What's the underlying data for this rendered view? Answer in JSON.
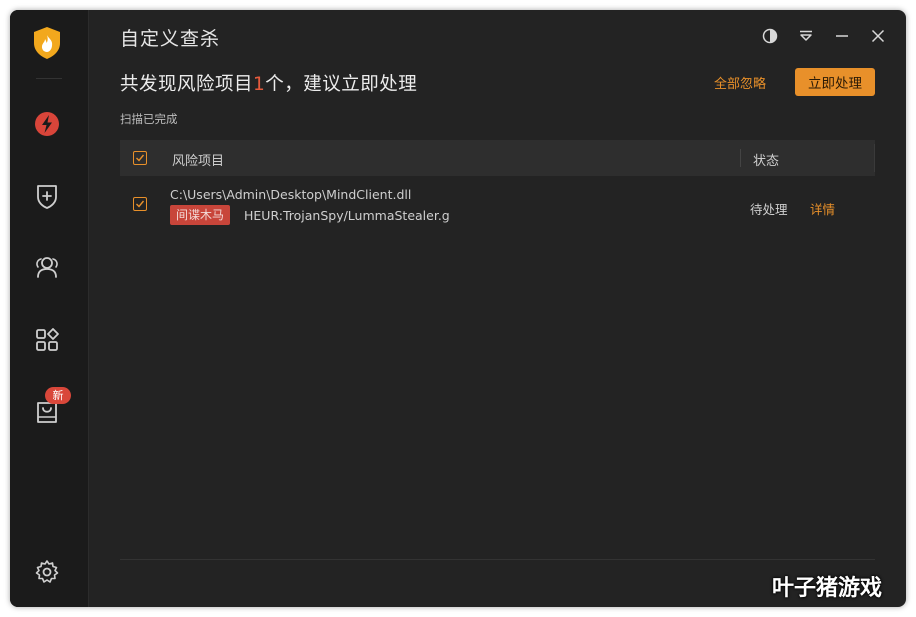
{
  "window": {
    "title": "自定义查杀",
    "controls": [
      "theme-icon",
      "menu-icon",
      "minimize-icon",
      "close-icon"
    ]
  },
  "sidebar": {
    "items": [
      {
        "name": "quick-scan",
        "icon": "lightning-icon",
        "active": true
      },
      {
        "name": "protection",
        "icon": "shield-plus-icon"
      },
      {
        "name": "users",
        "icon": "users-icon"
      },
      {
        "name": "apps",
        "icon": "apps-grid-icon"
      },
      {
        "name": "toolbox",
        "icon": "bag-icon",
        "badge": "新"
      }
    ],
    "settings_icon": "gear-icon"
  },
  "summary": {
    "prefix": "共发现风险项目",
    "count": "1",
    "suffix": "个，建议立即处理",
    "scan_status": "扫描已完成",
    "ignore_all_label": "全部忽略",
    "handle_now_label": "立即处理"
  },
  "table": {
    "headers": {
      "item": "风险项目",
      "status": "状态"
    },
    "rows": [
      {
        "path": "C:\\Users\\Admin\\Desktop\\MindClient.dll",
        "tag": "间谍木马",
        "virus_name": "HEUR:TrojanSpy/LummaStealer.g",
        "status": "待处理",
        "action": "详情",
        "checked": true
      }
    ]
  },
  "watermark": "叶子猪游戏",
  "colors": {
    "accent": "#e8902a",
    "danger": "#c8453a",
    "background": "#232323",
    "sidebar": "#1b1b1b"
  }
}
